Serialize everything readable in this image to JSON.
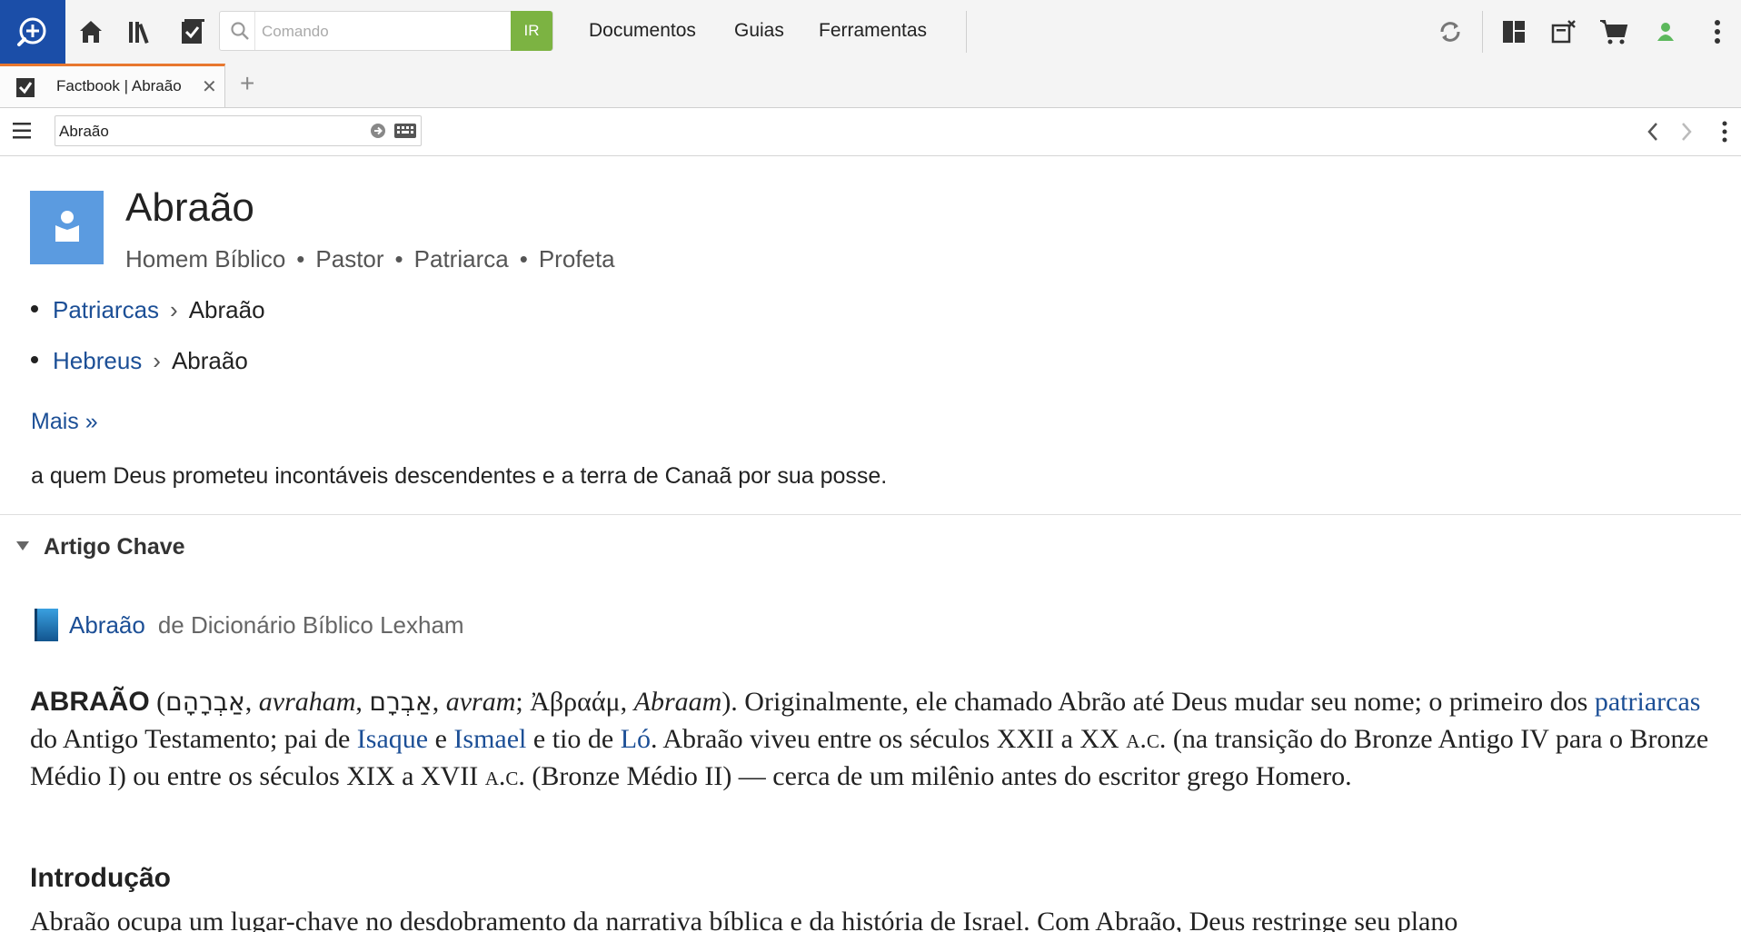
{
  "toolbar": {
    "search_placeholder": "Comando",
    "go_label": "IR",
    "menu": [
      "Documentos",
      "Guias",
      "Ferramentas"
    ]
  },
  "tabs": [
    {
      "title": "Factbook | Abraão",
      "close": "✕"
    }
  ],
  "new_tab": "+",
  "address": {
    "value": "Abraão"
  },
  "entity": {
    "name": "Abraão",
    "roles": [
      "Homem Bíblico",
      "Pastor",
      "Patriarca",
      "Profeta"
    ],
    "role_separator": "•"
  },
  "breadcrumbs": [
    {
      "parent": "Patriarcas",
      "child": "Abraão"
    },
    {
      "parent": "Hebreus",
      "child": "Abraão"
    }
  ],
  "breadcrumb_separator": "›",
  "more_link": "Mais »",
  "description": "a quem Deus prometeu incontáveis descendentes e a terra de Canaã por sua posse.",
  "section": {
    "title": "Artigo Chave"
  },
  "source": {
    "title": "Abraão",
    "from": "de Dicionário Bíblico Lexham"
  },
  "article": {
    "headword": "ABRAÃO",
    "p1": "(",
    "heb1": "אַבְרָהָם",
    "t1": ", ",
    "translit1": "avraham",
    "t2": ", ",
    "heb2": "אַבְרָם",
    "t3": ", ",
    "translit2": "avram",
    "t4": "; Ἀβραάμ, ",
    "translit3": "Abraam",
    "t5": "). Originalmente, ele chamado Abrão até Deus mudar seu nome; o primeiro dos ",
    "link_patriarcas": "patriarcas",
    "t6": " do Antigo Testamento; pai de ",
    "link_isaque": "Isaque",
    "t7": " e ",
    "link_ismael": "Ismael",
    "t8": " e tio de ",
    "link_lo": "Ló",
    "t9": ". Abraão viveu entre os séculos XXII a XX ",
    "ac1": "a.c.",
    "t10": " (na transição do Bronze Antigo IV para o Bronze Médio I) ou entre os séculos XIX a XVII ",
    "ac2": "a.c.",
    "t11": " (Bronze Médio II) — cerca de um milênio antes do escritor grego Homero.",
    "intro_heading": "Introdução",
    "intro_text": "Abraão ocupa um lugar-chave no desdobramento da narrativa bíblica e da história de Israel. Com Abraão, Deus restringe seu plano"
  },
  "colors": {
    "accent": "#1b4ea8",
    "go_button": "#7cb342",
    "tab_accent": "#e8772e",
    "link": "#1c4f96",
    "avatar": "#5b9be0",
    "status_online": "#5cb85c"
  }
}
